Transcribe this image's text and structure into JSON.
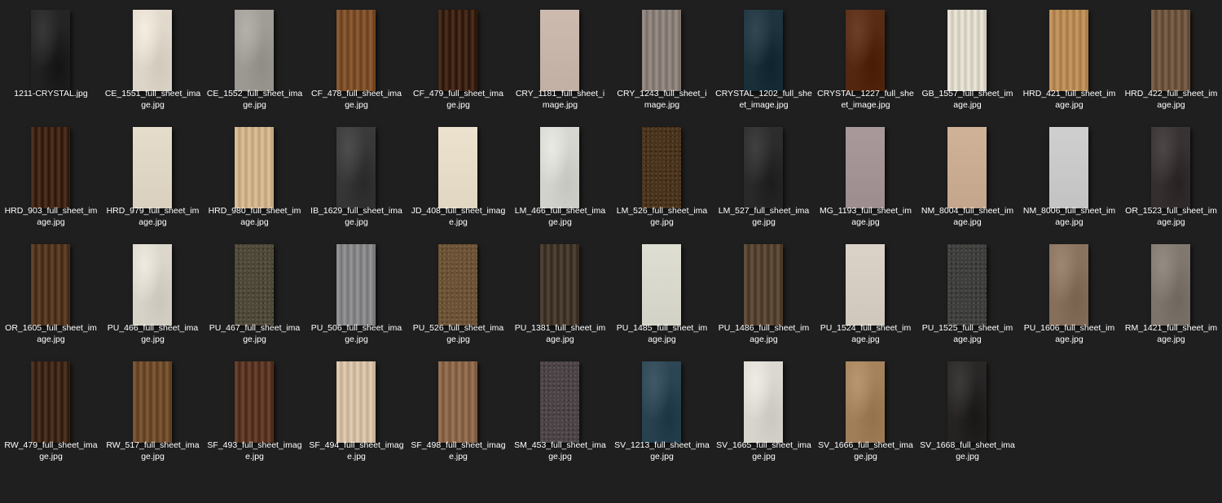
{
  "files": [
    {
      "name": "1211-CRYSTAL.jpg",
      "label": "1211-CRYSTAL.jpg",
      "swatch": "#262626",
      "pattern": "stone"
    },
    {
      "name": "CE_1551_full_sheet_image.jpg",
      "label": "CE_1551_full_sheet_ima\nge.jpg",
      "swatch": "#e3dcce",
      "pattern": "stone"
    },
    {
      "name": "CE_1552_full_sheet_image.jpg",
      "label": "CE_1552_full_sheet_ima\nge.jpg",
      "swatch": "#a29e98",
      "pattern": "stone"
    },
    {
      "name": "CF_478_full_sheet_image.jpg",
      "label": "CF_478_full_sheet_ima\nge.jpg",
      "swatch": "#7c4f2a",
      "pattern": "wood"
    },
    {
      "name": "CF_479_full_sheet_image.jpg",
      "label": "CF_479_full_sheet_ima\nge.jpg",
      "swatch": "#3b2214",
      "pattern": "wood"
    },
    {
      "name": "CRY_1181_full_sheet_image.jpg",
      "label": "CRY_1181_full_sheet_i\nmage.jpg",
      "swatch": "#c7b5aa",
      "pattern": "plain"
    },
    {
      "name": "CRY_1243_full_sheet_image.jpg",
      "label": "CRY_1243_full_sheet_i\nmage.jpg",
      "swatch": "#8a8079",
      "pattern": "wood"
    },
    {
      "name": "CRYSTAL_1202_full_sheet_image.jpg",
      "label": "CRYSTAL_1202_full_she\net_image.jpg",
      "swatch": "#203540",
      "pattern": "stone"
    },
    {
      "name": "CRYSTAL_1227_full_sheet_image.jpg",
      "label": "CRYSTAL_1227_full_she\net_image.jpg",
      "swatch": "#5a2d16",
      "pattern": "stone"
    },
    {
      "name": "GB_1557_full_sheet_image.jpg",
      "label": "GB_1557_full_sheet_im\nage.jpg",
      "swatch": "#ddd8c9",
      "pattern": "wood"
    },
    {
      "name": "HRD_421_full_sheet_image.jpg",
      "label": "HRD_421_full_sheet_im\nage.jpg",
      "swatch": "#b88a55",
      "pattern": "wood"
    },
    {
      "name": "HRD_422_full_sheet_image.jpg",
      "label": "HRD_422_full_sheet_im\nage.jpg",
      "swatch": "#6e553f",
      "pattern": "wood"
    },
    {
      "name": "HRD_903_full_sheet_image.jpg",
      "label": "HRD_903_full_sheet_im\nage.jpg",
      "swatch": "#3e2415",
      "pattern": "wood"
    },
    {
      "name": "HRD_979_full_sheet_image.jpg",
      "label": "HRD_979_full_sheet_im\nage.jpg",
      "swatch": "#e0d6c5",
      "pattern": "plain"
    },
    {
      "name": "HRD_980_full_sheet_image.jpg",
      "label": "HRD_980_full_sheet_im\nage.jpg",
      "swatch": "#cfb18a",
      "pattern": "wood"
    },
    {
      "name": "IB_1629_full_sheet_image.jpg",
      "label": "IB_1629_full_sheet_ima\nge.jpg",
      "swatch": "#3b3b3b",
      "pattern": "stone"
    },
    {
      "name": "JD_408_full_sheet_image.jpg",
      "label": "JD_408_full_sheet_imag\ne.jpg",
      "swatch": "#e7dcc8",
      "pattern": "plain"
    },
    {
      "name": "LM_466_full_sheet_image.jpg",
      "label": "LM_466_full_sheet_ima\nge.jpg",
      "swatch": "#d8d8d3",
      "pattern": "stone"
    },
    {
      "name": "LM_526_full_sheet_image.jpg",
      "label": "LM_526_full_sheet_ima\nge.jpg",
      "swatch": "#4a331c",
      "pattern": "speckle"
    },
    {
      "name": "LM_527_full_sheet_image.jpg",
      "label": "LM_527_full_sheet_ima\nge.jpg",
      "swatch": "#2e2e2e",
      "pattern": "stone"
    },
    {
      "name": "MG_1193_full_sheet_image.jpg",
      "label": "MG_1193_full_sheet_im\nage.jpg",
      "swatch": "#a39394",
      "pattern": "plain"
    },
    {
      "name": "NM_8004_full_sheet_image.jpg",
      "label": "NM_8004_full_sheet_im\nage.jpg",
      "swatch": "#c9ac92",
      "pattern": "plain"
    },
    {
      "name": "NM_8006_full_sheet_image.jpg",
      "label": "NM_8006_full_sheet_im\nage.jpg",
      "swatch": "#c9c9c9",
      "pattern": "plain"
    },
    {
      "name": "OR_1523_full_sheet_image.jpg",
      "label": "OR_1523_full_sheet_im\nage.jpg",
      "swatch": "#3a3434",
      "pattern": "stone"
    },
    {
      "name": "OR_1605_full_sheet_image.jpg",
      "label": "OR_1605_full_sheet_im\nage.jpg",
      "swatch": "#523620",
      "pattern": "wood"
    },
    {
      "name": "PU_466_full_sheet_image.jpg",
      "label": "PU_466_full_sheet_ima\nge.jpg",
      "swatch": "#ddd8cd",
      "pattern": "stone"
    },
    {
      "name": "PU_467_full_sheet_image.jpg",
      "label": "PU_467_full_sheet_ima\nge.jpg",
      "swatch": "#4e4838",
      "pattern": "speckle"
    },
    {
      "name": "PU_506_full_sheet_image.jpg",
      "label": "PU_506_full_sheet_ima\nge.jpg",
      "swatch": "#868688",
      "pattern": "wood"
    },
    {
      "name": "PU_526_full_sheet_image.jpg",
      "label": "PU_526_full_sheet_ima\nge.jpg",
      "swatch": "#6b5236",
      "pattern": "speckle"
    },
    {
      "name": "PU_1381_full_sheet_image.jpg",
      "label": "PU_1381_full_sheet_im\nage.jpg",
      "swatch": "#43372b",
      "pattern": "wood"
    },
    {
      "name": "PU_1485_full_sheet_image.jpg",
      "label": "PU_1485_full_sheet_im\nage.jpg",
      "swatch": "#d9d8cc",
      "pattern": "plain"
    },
    {
      "name": "PU_1486_full_sheet_image.jpg",
      "label": "PU_1486_full_sheet_im\nage.jpg",
      "swatch": "#564331",
      "pattern": "wood"
    },
    {
      "name": "PU_1524_full_sheet_image.jpg",
      "label": "PU_1524_full_sheet_im\nage.jpg",
      "swatch": "#d6cdc2",
      "pattern": "plain"
    },
    {
      "name": "PU_1525_full_sheet_image.jpg",
      "label": "PU_1525_full_sheet_im\nage.jpg",
      "swatch": "#3e3e3c",
      "pattern": "speckle"
    },
    {
      "name": "PU_1606_full_sheet_image.jpg",
      "label": "PU_1606_full_sheet_im\nage.jpg",
      "swatch": "#8b7460",
      "pattern": "stone"
    },
    {
      "name": "RM_1421_full_sheet_image.jpg",
      "label": "RM_1421_full_sheet_im\nage.jpg",
      "swatch": "#827970",
      "pattern": "stone"
    },
    {
      "name": "RW_479_full_sheet_image.jpg",
      "label": "RW_479_full_sheet_ima\nge.jpg",
      "swatch": "#3e2718",
      "pattern": "wood"
    },
    {
      "name": "RW_517_full_sheet_image.jpg",
      "label": "RW_517_full_sheet_ima\nge.jpg",
      "swatch": "#6e4c2c",
      "pattern": "wood"
    },
    {
      "name": "SF_493_full_sheet_image.jpg",
      "label": "SF_493_full_sheet_imag\ne.jpg",
      "swatch": "#5b3624",
      "pattern": "wood"
    },
    {
      "name": "SF_494_full_sheet_image.jpg",
      "label": "SF_494_full_sheet_imag\ne.jpg",
      "swatch": "#d3bea3",
      "pattern": "wood"
    },
    {
      "name": "SF_498_full_sheet_image.jpg",
      "label": "SF_498_full_sheet_imag\ne.jpg",
      "swatch": "#8a664a",
      "pattern": "wood"
    },
    {
      "name": "SM_453_full_sheet_image.jpg",
      "label": "SM_453_full_sheet_ima\nge.jpg",
      "swatch": "#4b4346",
      "pattern": "speckle"
    },
    {
      "name": "SV_1213_full_sheet_image.jpg",
      "label": "SV_1213_full_sheet_ima\nge.jpg",
      "swatch": "#2e4755",
      "pattern": "stone"
    },
    {
      "name": "SV_1665_full_sheet_image.jpg",
      "label": "SV_1665_full_sheet_ima\nge.jpg",
      "swatch": "#dcdad2",
      "pattern": "stone"
    },
    {
      "name": "SV_1666_full_sheet_image.jpg",
      "label": "SV_1666_full_sheet_ima\nge.jpg",
      "swatch": "#a6845e",
      "pattern": "stone"
    },
    {
      "name": "SV_1668_full_sheet_image.jpg",
      "label": "SV_1668_full_sheet_ima\nge.jpg",
      "swatch": "#2b2828",
      "pattern": "stone"
    }
  ]
}
